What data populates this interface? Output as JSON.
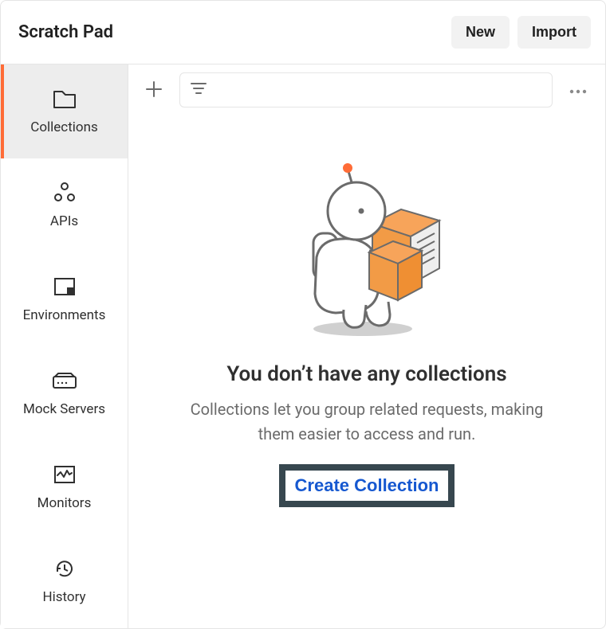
{
  "header": {
    "title": "Scratch Pad",
    "new_label": "New",
    "import_label": "Import"
  },
  "sidebar": {
    "items": [
      {
        "label": "Collections",
        "icon": "folder-icon",
        "active": true
      },
      {
        "label": "APIs",
        "icon": "apis-icon",
        "active": false
      },
      {
        "label": "Environments",
        "icon": "environments-icon",
        "active": false
      },
      {
        "label": "Mock Servers",
        "icon": "mock-servers-icon",
        "active": false
      },
      {
        "label": "Monitors",
        "icon": "monitors-icon",
        "active": false
      },
      {
        "label": "History",
        "icon": "history-icon",
        "active": false
      }
    ]
  },
  "toolbar": {
    "add_icon": "plus-icon",
    "filter_icon": "filter-icon",
    "filter_placeholder": "",
    "more_icon": "more-horizontal-icon"
  },
  "empty_state": {
    "title": "You don’t have any collections",
    "description": "Collections let you group related requests, making them easier to access and run.",
    "cta_label": "Create Collection"
  },
  "colors": {
    "accent": "#ff6c37",
    "link": "#1658d0",
    "highlight_border": "#37474f",
    "text_primary": "#212121",
    "text_secondary": "#6b6b6b",
    "border": "#e5e5e5",
    "sidebar_active_bg": "#ededed"
  }
}
